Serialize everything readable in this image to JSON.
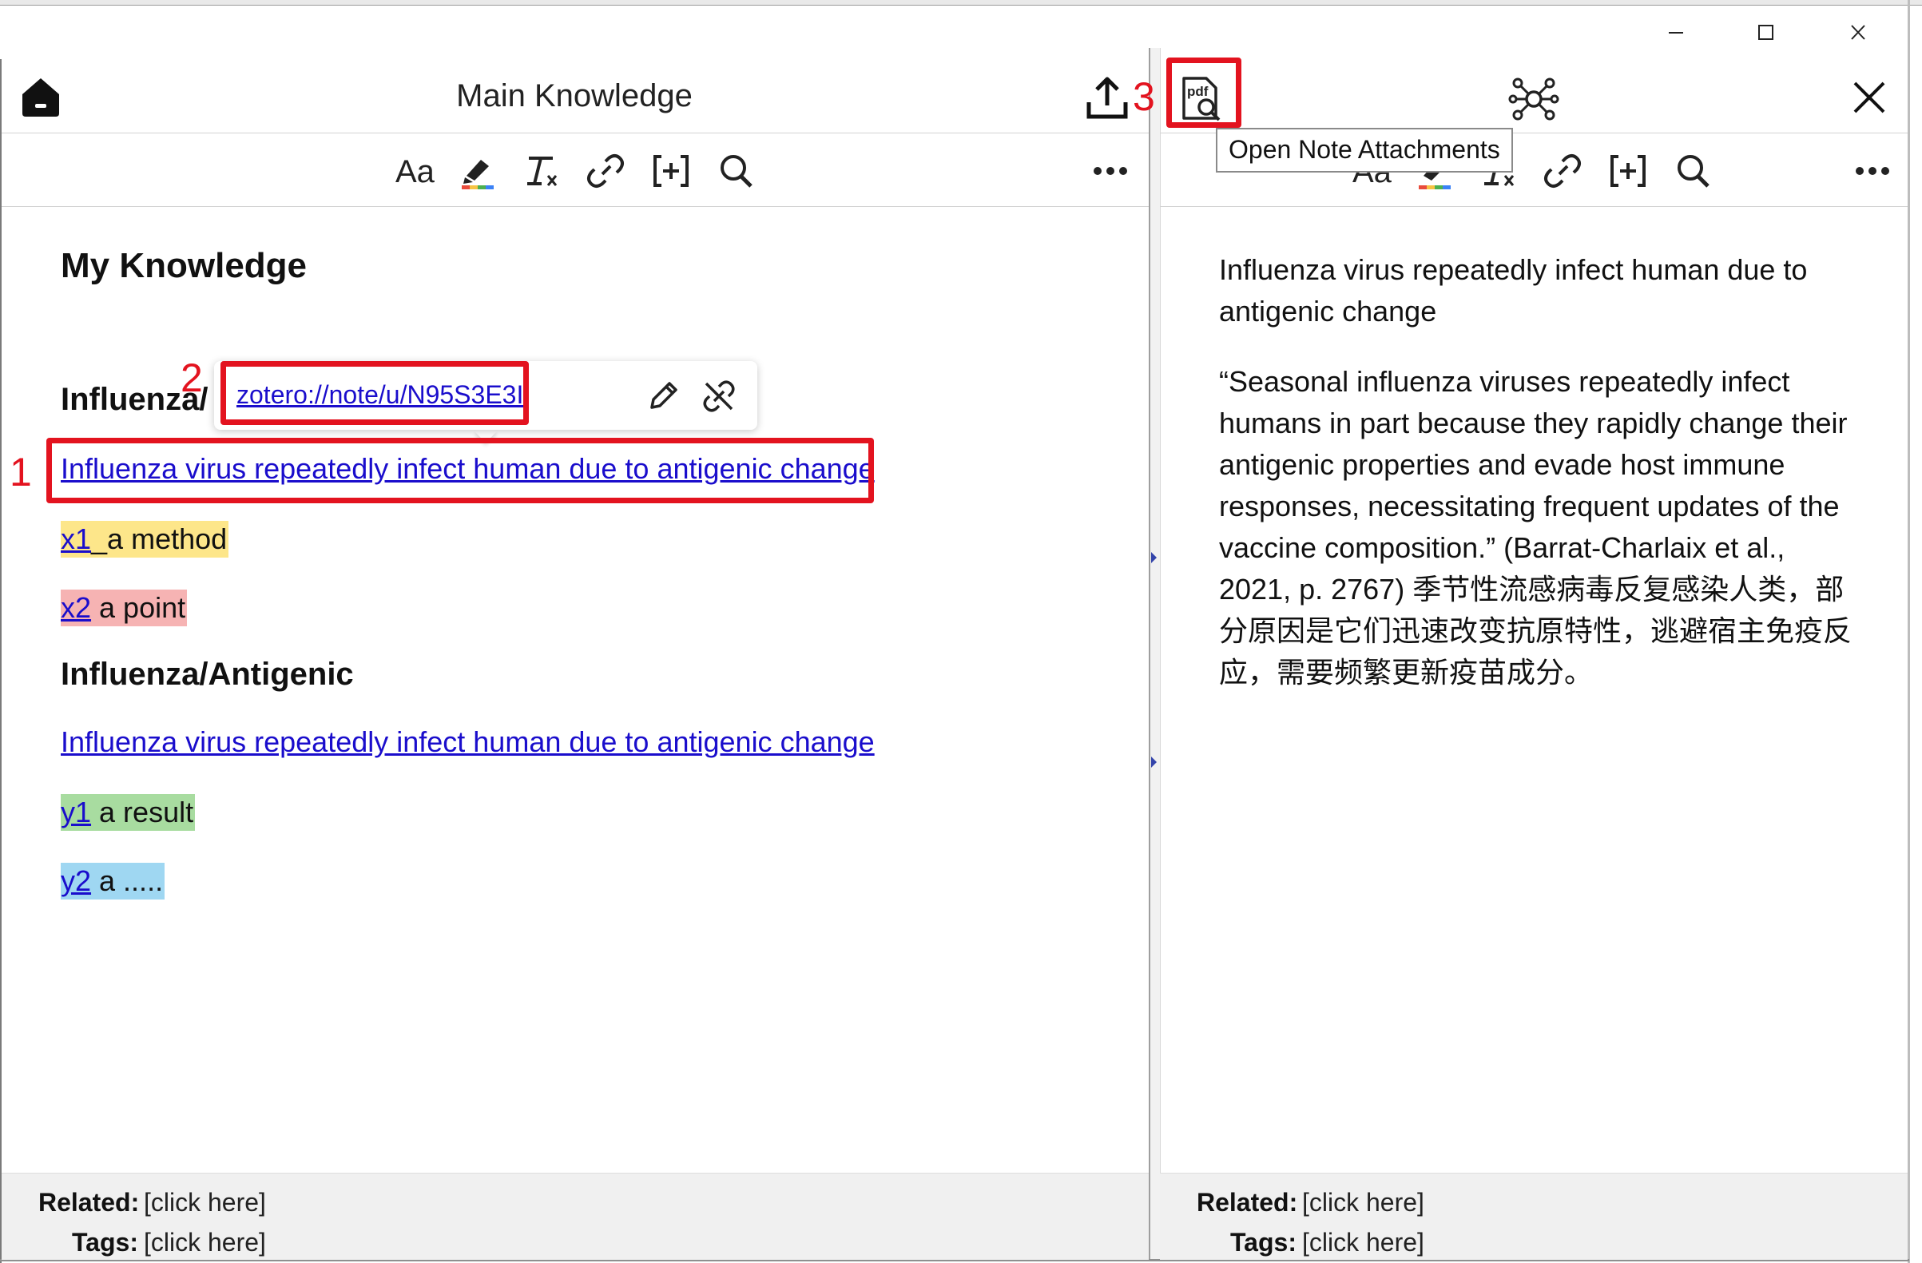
{
  "window": {
    "controls": {
      "minimize_icon": "minimize-icon",
      "maximize_icon": "maximize-icon",
      "close_icon": "close-icon"
    }
  },
  "left_pane": {
    "title": "Main Knowledge",
    "toolbar": [
      "Aa",
      "highlight",
      "clear-format",
      "link",
      "insert-citation",
      "search",
      "more"
    ],
    "content": {
      "heading": "My Knowledge",
      "section1_heading": "Influenza/",
      "section1_link": "Influenza virus repeatedly infect human due to antigenic change",
      "items1": [
        {
          "link": "x1",
          "text": "_a method",
          "color": "#fde68a"
        },
        {
          "link": "x2",
          "text": " a point",
          "color": "#f6b3b3"
        }
      ],
      "section2_heading": "Influenza/Antigenic",
      "section2_link": "Influenza virus repeatedly infect human due to antigenic change",
      "items2": [
        {
          "link": "y1",
          "text": " a result",
          "color": "#a8dca0"
        },
        {
          "link": "y2",
          "text": " a .....",
          "color": "#9fd7f2"
        }
      ]
    },
    "link_popup": {
      "url": "zotero://note/u/N95S3E3I"
    },
    "footer": {
      "related_label": "Related:",
      "related_value": "[click here]",
      "tags_label": "Tags:",
      "tags_value": "[click here]"
    }
  },
  "right_pane": {
    "tooltip": "Open Note Attachments",
    "content": {
      "title_line1": "Influenza virus repeatedly infect human due to",
      "title_line2": "antigenic change",
      "body_lines": [
        "“Seasonal influenza viruses repeatedly infect",
        "humans in part because they rapidly change their",
        "antigenic properties and evade host immune",
        "responses, necessitating frequent updates of the",
        "vaccine composition.” (Barrat-Charlaix et al.,",
        "2021, p. 2767) 季节性流感病毒反复感染人类，部",
        "分原因是它们迅速改变抗原特性，逃避宿主免疫反",
        "应，需要频繁更新疫苗成分。"
      ]
    },
    "footer": {
      "related_label": "Related:",
      "related_value": "[click here]",
      "tags_label": "Tags:",
      "tags_value": "[click here]"
    }
  },
  "annotations": {
    "n1": "1",
    "n2": "2",
    "n3": "3"
  },
  "colors": {
    "annotation_red": "#e3131f",
    "link_blue": "#1a0dcc"
  }
}
